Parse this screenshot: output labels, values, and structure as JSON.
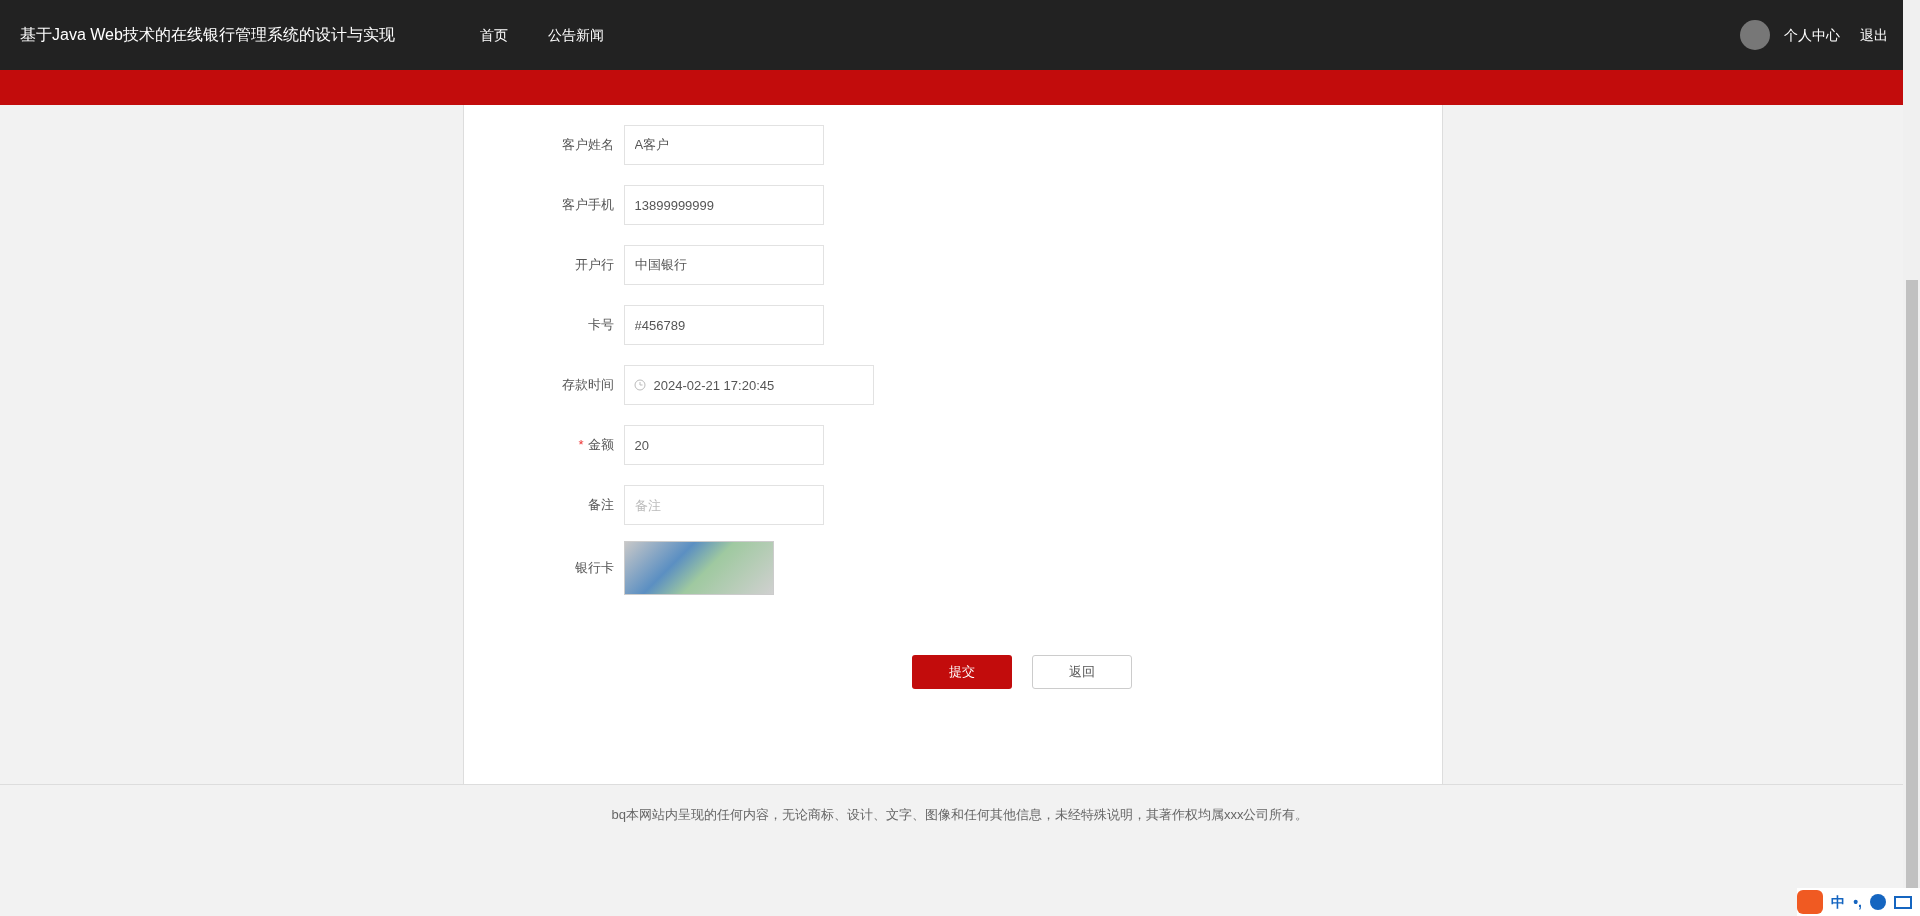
{
  "header": {
    "title": "基于Java Web技术的在线银行管理系统的设计与实现",
    "nav": [
      {
        "label": "首页"
      },
      {
        "label": "公告新闻"
      }
    ],
    "user_links": [
      {
        "label": "个人中心"
      },
      {
        "label": "退出"
      }
    ]
  },
  "form": {
    "required_mark": "*",
    "fields": [
      {
        "kind": "text",
        "label": "客户姓名",
        "value": "A客户",
        "required": false
      },
      {
        "kind": "text",
        "label": "客户手机",
        "value": "13899999999",
        "required": false
      },
      {
        "kind": "text",
        "label": "开户行",
        "value": "中国银行",
        "required": false
      },
      {
        "kind": "text",
        "label": "卡号",
        "value": "#456789",
        "required": false
      },
      {
        "kind": "datetime",
        "label": "存款时间",
        "value": "2024-02-21 17:20:45",
        "required": false
      },
      {
        "kind": "text",
        "label": "金额",
        "value": "20",
        "required": true
      },
      {
        "kind": "text",
        "label": "备注",
        "placeholder": "备注",
        "required": false
      },
      {
        "kind": "image",
        "label": "银行卡"
      }
    ],
    "buttons": [
      {
        "label": "提交",
        "kind": "primary"
      },
      {
        "label": "返回",
        "kind": "secondary"
      }
    ]
  },
  "footer": {
    "text": "bq本网站内呈现的任何内容，无论商标、设计、文字、图像和任何其他信息，未经特殊说明，其著作权均属xxx公司所有。"
  },
  "ime_toolbar": {
    "mode": "中",
    "punct": "•,"
  }
}
